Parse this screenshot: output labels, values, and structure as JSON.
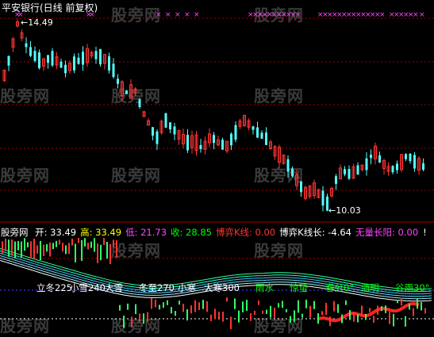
{
  "title": "平安银行(日线 前复权)",
  "watermark": "股旁网",
  "price_labels": {
    "high": "14.49",
    "low": "10.03"
  },
  "info_bar": {
    "brand": "股旁网",
    "items": [
      {
        "label": "开:",
        "value": "33.49",
        "color": "#ffffff"
      },
      {
        "label": "高:",
        "value": "33.49",
        "color": "#ffff00"
      },
      {
        "label": "低:",
        "value": "21.73",
        "color": "#ff44ff"
      },
      {
        "label": "收:",
        "value": "28.85",
        "color": "#00ff00"
      },
      {
        "label": "博弈K线:",
        "value": "0.00",
        "color": "#ff3333"
      },
      {
        "label": "博弈K线长:",
        "value": "-4.64",
        "color": "#ffffff"
      },
      {
        "label": "无量长阳:",
        "value": "0.00",
        "color": "#ff44ff"
      }
    ],
    "tail": "!"
  },
  "solar_terms": [
    {
      "text": "立冬225",
      "color": "#ffffff"
    },
    {
      "text": "小雪240",
      "color": "#ffffff"
    },
    {
      "text": "大雪",
      "color": "#ffffff"
    },
    {
      "text": "冬至270",
      "color": "#ffffff"
    },
    {
      "text": "小寒",
      "color": "#ffffff"
    },
    {
      "text": "大寒300",
      "color": "#ffffff"
    },
    {
      "text": "雨水",
      "color": "#00ff00"
    },
    {
      "text": "惊蛰",
      "color": "#00ff00"
    },
    {
      "text": "春分0°",
      "color": "#00ff00"
    },
    {
      "text": "清明",
      "color": "#00ff00"
    },
    {
      "text": "谷雨30°",
      "color": "#00ff00"
    }
  ],
  "colors": {
    "up": "#ff3333",
    "down": "#54fcfc",
    "grid": "#a00000",
    "marker": "#ff44ff",
    "background": "#000000"
  }
}
